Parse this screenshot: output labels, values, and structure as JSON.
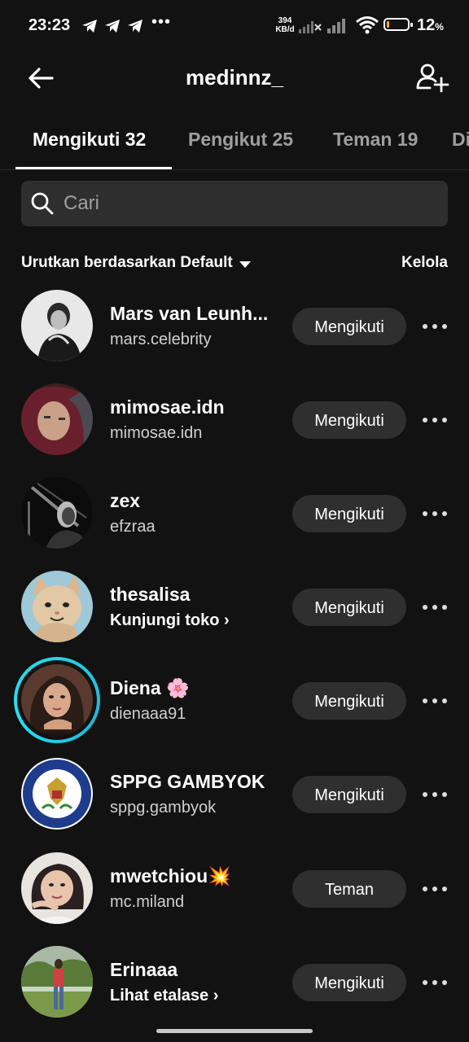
{
  "status_bar": {
    "time": "23:23",
    "overflow_icon": "•••",
    "net_speed_value": "394",
    "net_speed_unit": "KB/d",
    "battery_percent": "12",
    "battery_unit": "%",
    "battery_level": 0.12
  },
  "nav": {
    "title": "medinnz_"
  },
  "tabs": [
    {
      "label": "Mengikuti 32"
    },
    {
      "label": "Pengikut 25"
    },
    {
      "label": "Teman 19"
    },
    {
      "label": "Di"
    }
  ],
  "search": {
    "placeholder": "Cari"
  },
  "sort": {
    "label": "Urutkan berdasarkan Default",
    "manage_label": "Kelola"
  },
  "users": [
    {
      "name": "Mars van Leunh...",
      "sub": "mars.celebrity",
      "button": "Mengikuti"
    },
    {
      "name": "mimosae.idn",
      "sub": "mimosae.idn",
      "button": "Mengikuti"
    },
    {
      "name": "zex",
      "sub": "efzraa",
      "button": "Mengikuti"
    },
    {
      "name": "thesalisa",
      "sub": "Kunjungi toko ›",
      "button": "Mengikuti"
    },
    {
      "name": "Diena",
      "emoji": "🌸",
      "sub": "dienaaa91",
      "button": "Mengikuti"
    },
    {
      "name": "SPPG GAMBYOK",
      "sub": "sppg.gambyok",
      "button": "Mengikuti"
    },
    {
      "name": "mwetchiou",
      "emoji": "💥",
      "sub": "mc.miland",
      "button": "Teman"
    },
    {
      "name": "Erinaaa",
      "sub": "Lihat etalase ›",
      "button": "Mengikuti"
    }
  ],
  "colors": {
    "background": "#121212",
    "button_bg": "#2f2f2f",
    "search_bg": "#2e2e2e",
    "story_ring": "#2ad2e6",
    "battery_fill": "#f0a830"
  },
  "icons": {
    "back": "arrow-left-icon",
    "add_user": "add-user-icon",
    "search": "search-icon",
    "more": "more-horizontal-icon",
    "sort_caret": "caret-down-icon"
  }
}
